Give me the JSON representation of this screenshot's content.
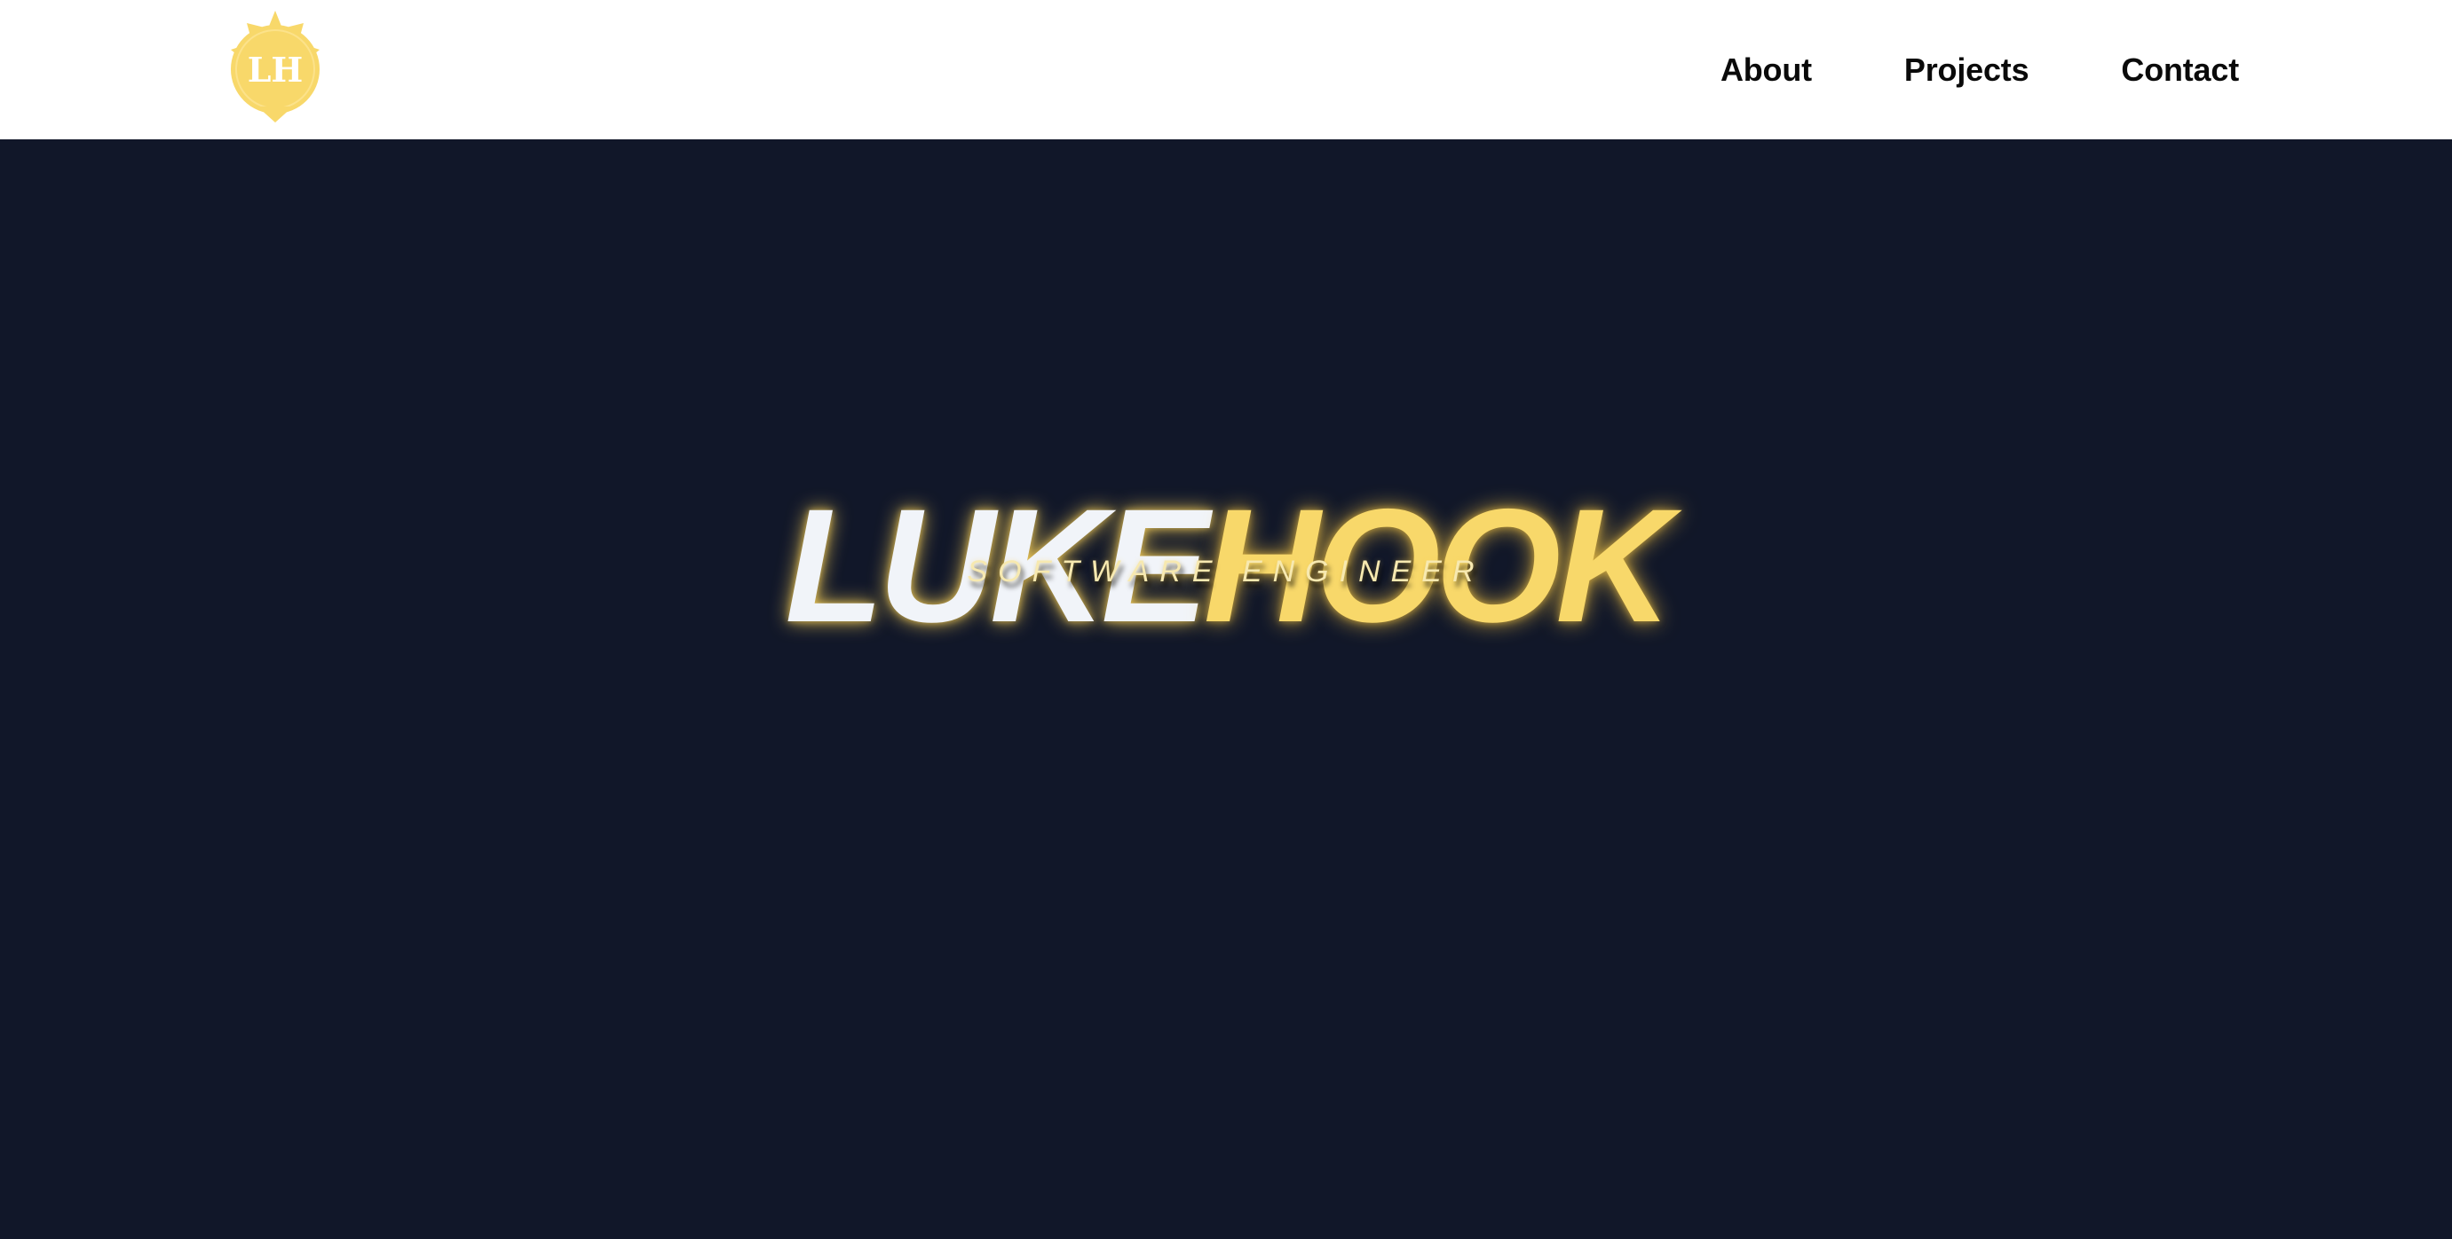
{
  "logo": {
    "initials": "LH",
    "icon": "star-badge-icon",
    "color": "#f8d86a"
  },
  "nav": {
    "items": [
      {
        "label": "About"
      },
      {
        "label": "Projects"
      },
      {
        "label": "Contact"
      }
    ]
  },
  "hero": {
    "title_first": "LUKE",
    "title_last": "HOOK",
    "subtitle": "SOFTWARE ENGINEER",
    "background": "#111729",
    "accent": "#f8d86a"
  }
}
